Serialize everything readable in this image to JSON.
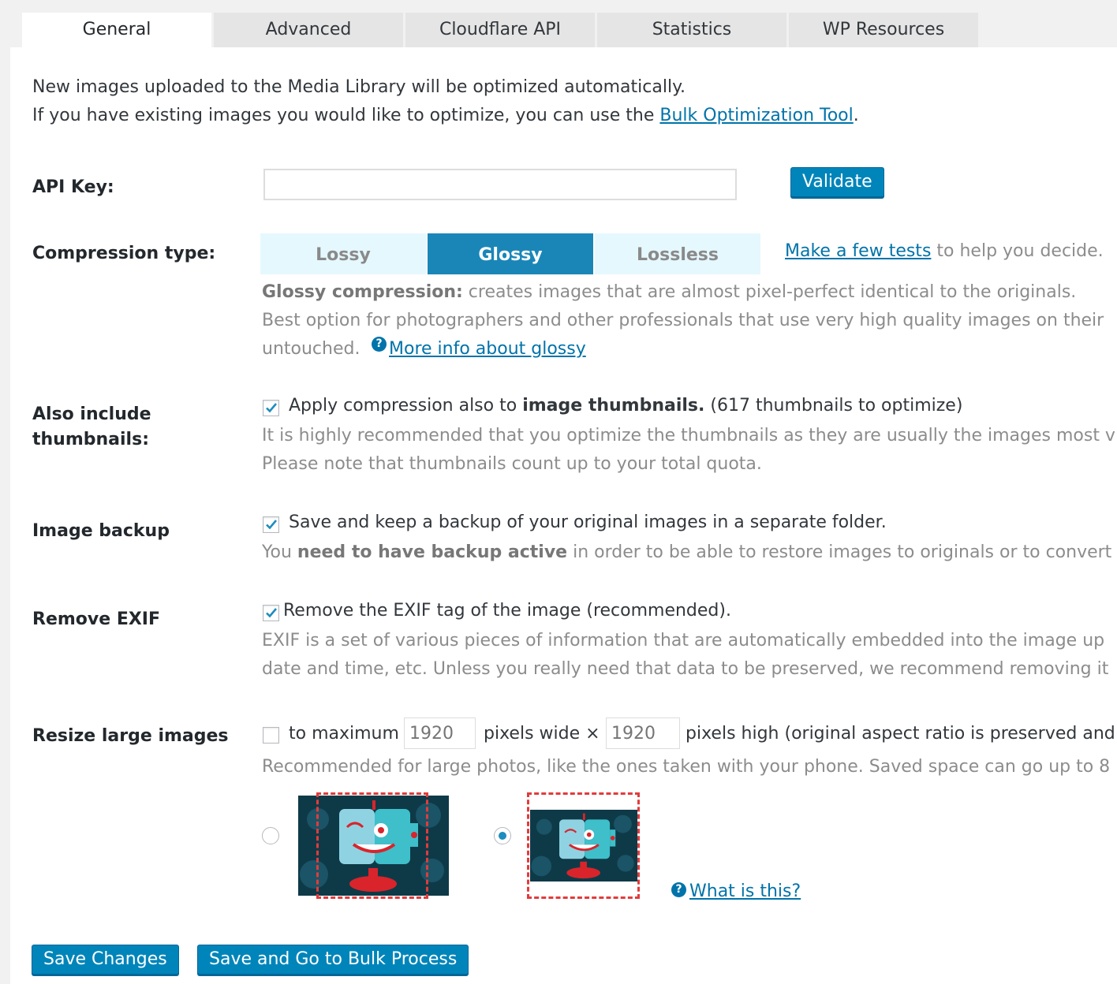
{
  "tabs": [
    "General",
    "Advanced",
    "Cloudflare API",
    "Statistics",
    "WP Resources"
  ],
  "active_tab": "General",
  "intro": {
    "line1": "New images uploaded to the Media Library will be optimized automatically.",
    "line2_prefix": "If you have existing images you would like to optimize, you can use the ",
    "line2_link": "Bulk Optimization Tool",
    "line2_suffix": "."
  },
  "api_key": {
    "label": "API Key:",
    "value": "",
    "validate_label": "Validate"
  },
  "compression": {
    "label": "Compression type:",
    "options": [
      "Lossy",
      "Glossy",
      "Lossless"
    ],
    "selected": "Glossy",
    "tests_link": "Make a few tests",
    "tests_suffix": " to help you decide.",
    "desc_title": "Glossy compression:",
    "desc_line1": " creates images that are almost pixel-perfect identical to the originals.",
    "desc_line2": "Best option for photographers and other professionals that use very high quality images on their",
    "desc_line3": "untouched.",
    "more_info_link": "More info about glossy"
  },
  "thumbnails": {
    "label_line1": "Also include",
    "label_line2": "thumbnails:",
    "checked": true,
    "text_prefix": "Apply compression also to ",
    "text_bold": "image thumbnails.",
    "text_suffix": " (617 thumbnails to optimize)",
    "desc_line1": "It is highly recommended that you optimize the thumbnails as they are usually the images most v",
    "desc_line2": "Please note that thumbnails count up to your total quota."
  },
  "backup": {
    "label": "Image backup",
    "checked": true,
    "text": "Save and keep a backup of your original images in a separate folder.",
    "desc_prefix": "You ",
    "desc_bold": "need to have backup active",
    "desc_suffix": " in order to be able to restore images to originals or to convert f"
  },
  "exif": {
    "label": "Remove EXIF",
    "checked": true,
    "text": "Remove the EXIF tag of the image (recommended).",
    "desc_line1": "EXIF is a set of various pieces of information that are automatically embedded into the image up",
    "desc_line2": "date and time, etc. Unless you really need that data to be preserved, we recommend removing it"
  },
  "resize": {
    "label": "Resize large images",
    "checked": false,
    "to_max": "to maximum",
    "width_placeholder": "1920",
    "pixels_wide": "pixels wide ×",
    "height_placeholder": "1920",
    "pixels_high": "pixels high (original aspect ratio is preserved and",
    "desc": "Recommended for large photos, like the ones taken with your phone. Saved space can go up to 8",
    "what_link": "What is this?",
    "selected_mode": 2
  },
  "buttons": {
    "save": "Save Changes",
    "save_bulk": "Save and Go to Bulk Process"
  },
  "colors": {
    "primary": "#0085ba",
    "link": "#0073aa",
    "segment_active": "#1a86b8",
    "segment_inactive": "#e5f8fe",
    "dashed_border": "#e23b3b"
  }
}
